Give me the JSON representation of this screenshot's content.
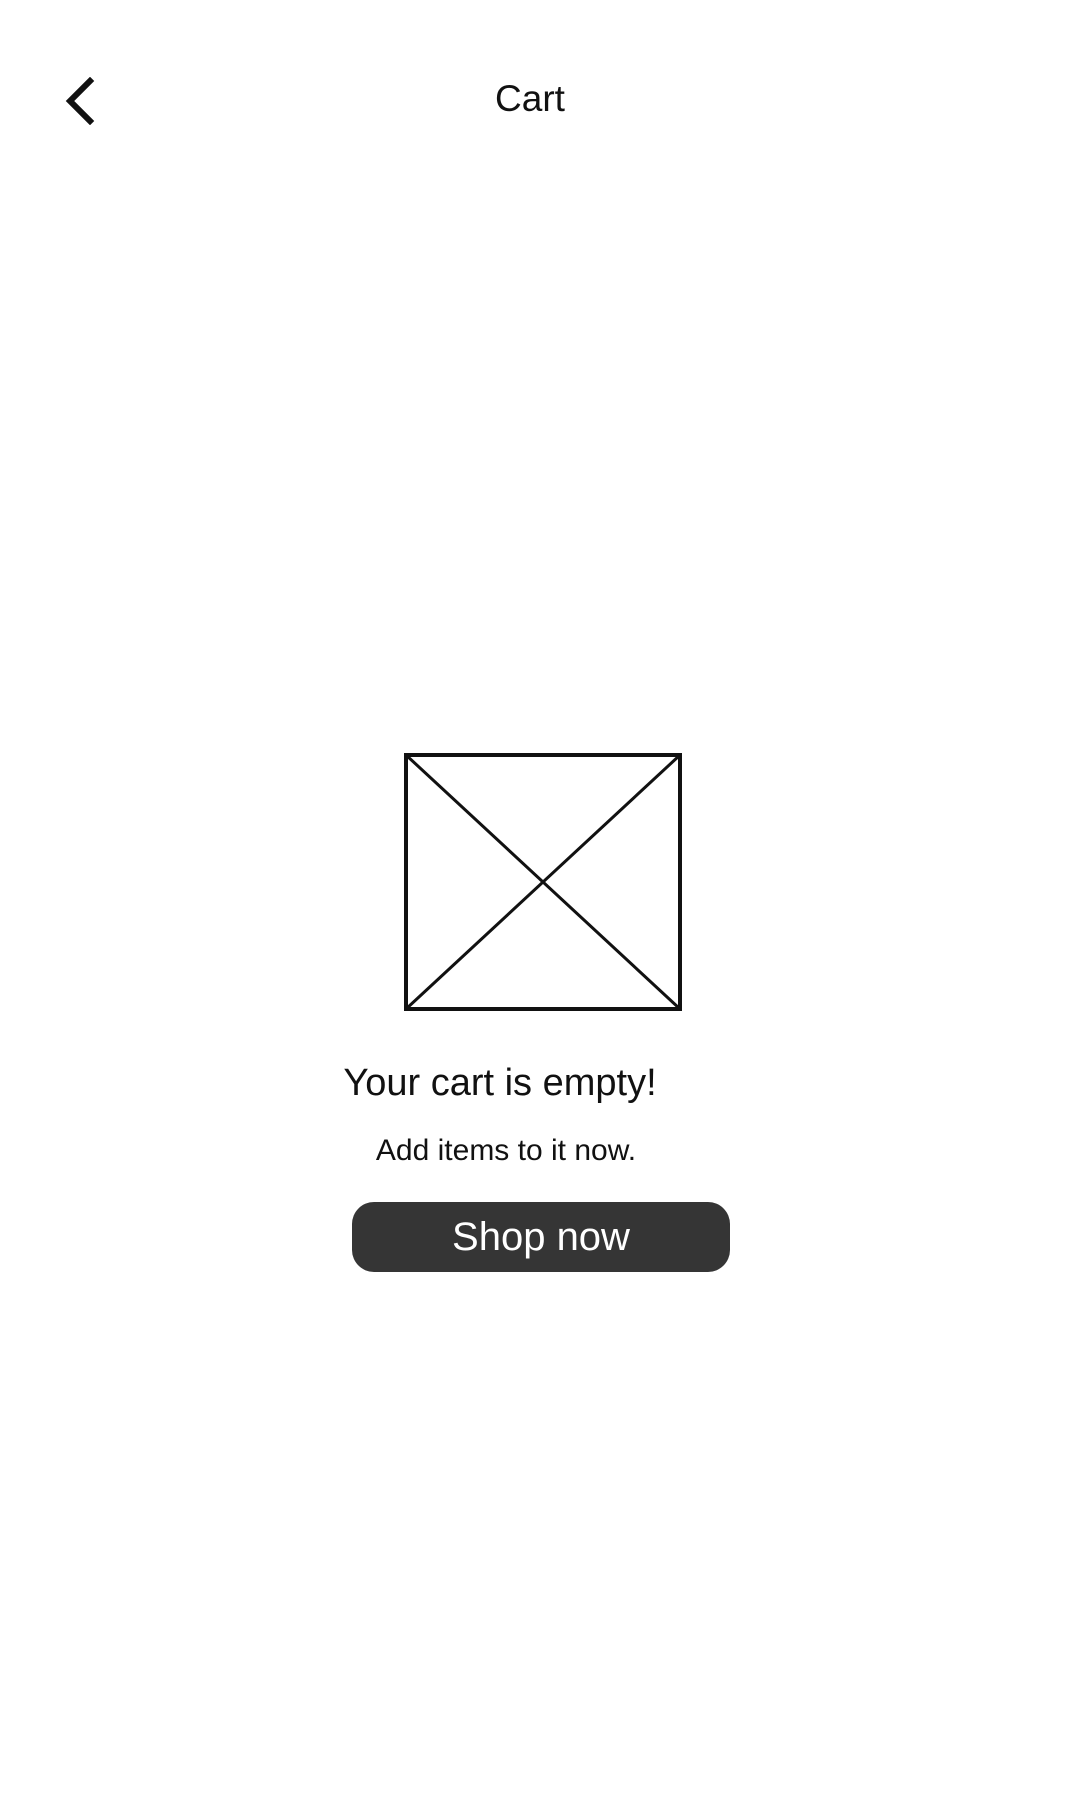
{
  "header": {
    "title": "Cart",
    "back_icon": "chevron-left-icon"
  },
  "empty_state": {
    "image_icon": "image-placeholder-icon",
    "title": "Your cart is empty!",
    "subtitle": "Add items to it now.",
    "button_label": "Shop now"
  },
  "colors": {
    "background": "#ffffff",
    "text": "#111111",
    "button_background": "#353535",
    "button_text": "#ffffff"
  }
}
